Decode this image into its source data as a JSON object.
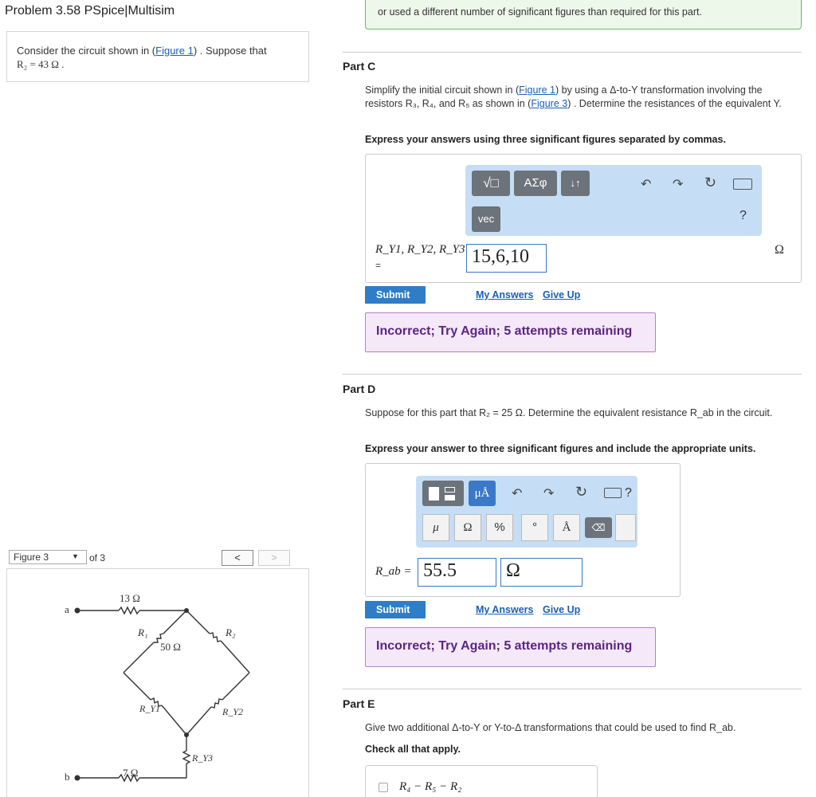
{
  "title": "Problem 3.58 PSpice|Multisim",
  "context": {
    "text_prefix": "Consider the circuit shown in (",
    "figure_link": "Figure 1",
    "text_suffix": ") . Suppose that",
    "r2": "R₂ = 43  Ω ."
  },
  "figure_nav": {
    "select_value": "Figure 3",
    "of_text": "of 3",
    "prev": "<",
    "next": ">"
  },
  "figure": {
    "label_a": "a",
    "label_b": "b",
    "r_top_value": "13 Ω",
    "r_bottom_value": "7 Ω",
    "r1_label": "R₁",
    "r1_value": "50 Ω",
    "r2_label": "R₂",
    "ry1_label": "R_Y1",
    "ry2_label": "R_Y2",
    "ry3_label": "R_Y3"
  },
  "top_feedback": "or used a different number of significant figures than required for this part.",
  "part_c": {
    "label": "Part C",
    "q1": "Simplify the initial circuit shown in (",
    "q1_link": "Figure 1",
    "q2": ") by using a Δ-to-Y transformation involving the resistors R₃, R₄, and R₅ as shown in (",
    "q2_link": "Figure 3",
    "q3": ") . Determine the resistances of the equivalent Y.",
    "instruction": "Express your answers using three significant figures separated by commas.",
    "toolbar_sqrt": "√□",
    "toolbar_greek": "ΑΣφ",
    "toolbar_arrows": "↓↑",
    "toolbar_vec": "vec",
    "help": "?",
    "input_label": "R_Y1, R_Y2, R_Y3",
    "input_eq": "=",
    "input_value": "15,6,10",
    "unit": "Ω",
    "submit": "Submit",
    "my_answers": "My Answers",
    "give_up": "Give Up",
    "feedback": "Incorrect; Try Again; 5 attempts remaining"
  },
  "part_d": {
    "label": "Part D",
    "q1": "Suppose for this part that R₂ = 25 Ω. Determine the equivalent resistance R_ab in the circuit.",
    "instruction": "Express your answer to three significant figures and include the appropriate units.",
    "unit_btn": "μÅ",
    "help": "?",
    "keys": [
      "μ",
      "Ω",
      "%",
      "°",
      "Å"
    ],
    "input_label": "R_ab =",
    "input_value": "55.5",
    "input_unit": "Ω",
    "submit": "Submit",
    "my_answers": "My Answers",
    "give_up": "Give Up",
    "feedback": "Incorrect; Try Again; 5 attempts remaining"
  },
  "part_e": {
    "label": "Part E",
    "q1": "Give two additional Δ-to-Y or Y-to-Δ transformations that could be used to find R_ab.",
    "instruction": "Check all that apply.",
    "option1": "R₄ − R₅ − R₂"
  },
  "colors": {
    "submit_blue": "#2e7dc6",
    "toolbar_bg": "#c6def5",
    "incorrect_bg": "#f5e8f8",
    "incorrect_text": "#5a2680",
    "feedback_green": "#eef8ea"
  }
}
